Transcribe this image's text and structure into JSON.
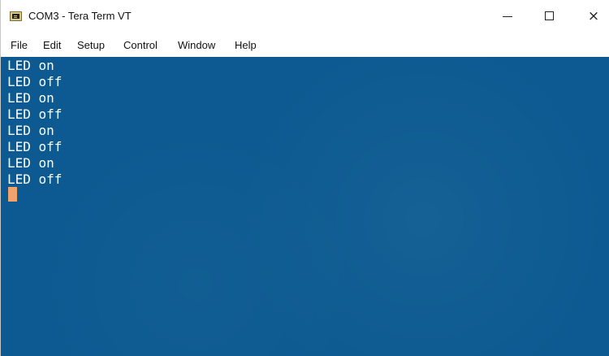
{
  "window": {
    "title": "COM3 - Tera Term VT",
    "icon": "tera-term-icon",
    "controls": {
      "minimize_icon": "minimize-icon",
      "maximize_icon": "maximize-icon",
      "close_icon": "close-icon",
      "close_label": "×"
    }
  },
  "menu": {
    "items": [
      {
        "label": "File"
      },
      {
        "label": "Edit"
      },
      {
        "label": "Setup"
      },
      {
        "label": "Control"
      },
      {
        "label": "Window"
      },
      {
        "label": "Help"
      }
    ]
  },
  "terminal": {
    "lines": [
      "LED on",
      "LED off",
      "LED on",
      "LED off",
      "LED on",
      "LED off",
      "LED on",
      "LED off"
    ],
    "background_color": "#0c5a91",
    "text_color": "#ffffff",
    "cursor_color": "#f2a36b"
  }
}
